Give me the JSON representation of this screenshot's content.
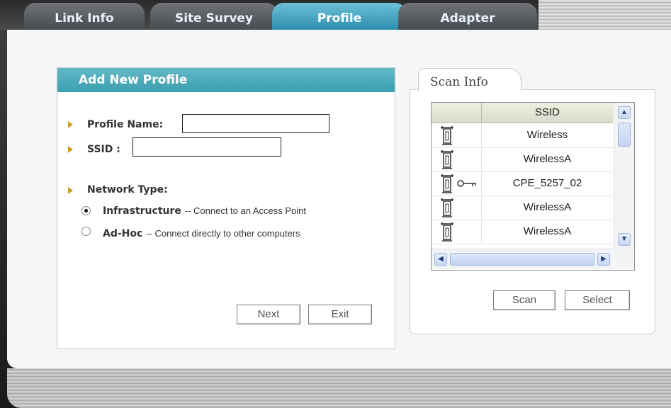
{
  "tabs": [
    {
      "label": "Link Info",
      "active": false
    },
    {
      "label": "Site Survey",
      "active": false
    },
    {
      "label": "Profile",
      "active": true
    },
    {
      "label": "Adapter",
      "active": false
    }
  ],
  "add_profile": {
    "title": "Add New Profile",
    "profile_name_label": "Profile Name:",
    "profile_name_value": "",
    "ssid_label": "SSID :",
    "ssid_value": "",
    "network_type_label": "Network Type:",
    "options": [
      {
        "name": "Infrastructure",
        "desc": "-- Connect to an Access Point",
        "selected": true
      },
      {
        "name": "Ad-Hoc",
        "desc": "-- Connect directly to other computers",
        "selected": false
      }
    ],
    "next_label": "Next",
    "exit_label": "Exit"
  },
  "scan_info": {
    "tab_label": "Scan Info",
    "column_ssid": "SSID",
    "rows": [
      {
        "ssid": "Wireless",
        "secured": false
      },
      {
        "ssid": "WirelessA",
        "secured": false
      },
      {
        "ssid": "CPE_5257_02",
        "secured": true
      },
      {
        "ssid": "WirelessA",
        "secured": false
      },
      {
        "ssid": "WirelessA",
        "secured": false
      }
    ],
    "scan_label": "Scan",
    "select_label": "Select"
  },
  "icons": {
    "signal": "signal-tower-icon",
    "key": "key-icon",
    "bullet": "arrow-bullet-icon"
  },
  "colors": {
    "header_teal": "#4aaabb",
    "tab_active": "#3a9cbf",
    "bullet_gold": "#c9a21c"
  }
}
